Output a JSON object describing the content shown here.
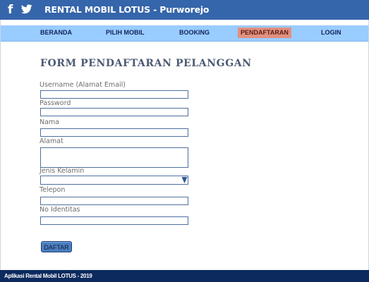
{
  "header": {
    "facebook_icon": "f",
    "twitter_icon": "twitter-bird",
    "title": "RENTAL MOBIL LOTUS - Purworejo",
    "bar_color": "#3565aa"
  },
  "nav": {
    "items": [
      {
        "label": "BERANDA"
      },
      {
        "label": "PILIH MOBIL"
      },
      {
        "label": "BOOKING"
      },
      {
        "label": "PENDAFTARAN",
        "active": true
      },
      {
        "label": "LOGIN"
      }
    ],
    "bar_color": "#99ccff",
    "active_color": "#e29080"
  },
  "form": {
    "title": "FORM PENDAFTARAN PELANGGAN",
    "fields": {
      "username": {
        "label": "Username (Alamat Email)",
        "value": ""
      },
      "password": {
        "label": "Password",
        "value": ""
      },
      "nama": {
        "label": "Nama",
        "value": ""
      },
      "alamat": {
        "label": "Alamat",
        "value": ""
      },
      "jenis_kelamin": {
        "label": "Jenis Kelamin",
        "value": ""
      },
      "telepon": {
        "label": "Telepon",
        "value": ""
      },
      "no_identitas": {
        "label": "No Identitas",
        "value": ""
      }
    },
    "submit_label": "DAFTAR"
  },
  "footer": {
    "text": "Aplikasi Rental Mobil LOTUS - 2019",
    "color": "#0c2a5e"
  }
}
